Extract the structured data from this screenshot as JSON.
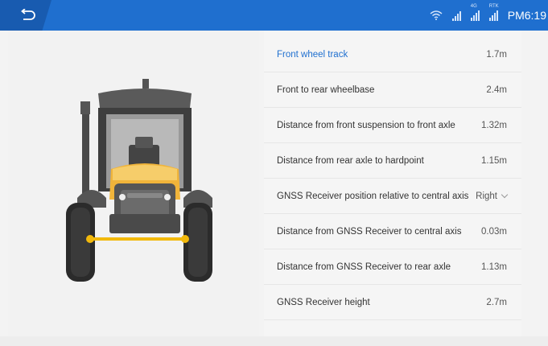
{
  "statusbar": {
    "time": "PM6:19",
    "signal_labels": [
      "4G",
      "RTK"
    ]
  },
  "settings": {
    "rows": [
      {
        "label": "Front wheel track",
        "value": "1.7m",
        "active": true
      },
      {
        "label": "Front to rear wheelbase",
        "value": "2.4m"
      },
      {
        "label": "Distance from front suspension to front axle",
        "value": "1.32m"
      },
      {
        "label": "Distance from rear axle to hardpoint",
        "value": "1.15m"
      },
      {
        "label": "GNSS Receiver position relative to central axis",
        "value": "Right",
        "dropdown": true
      },
      {
        "label": "Distance from GNSS Receiver to central axis",
        "value": "0.03m"
      },
      {
        "label": "Distance from GNSS Receiver to rear axle",
        "value": "1.13m"
      },
      {
        "label": "GNSS Receiver height",
        "value": "2.7m"
      }
    ]
  },
  "colors": {
    "topbar": "#1f6fcf",
    "accent": "#1f6fcf",
    "highlight_axle": "#f2b90c",
    "tractor_body": "#4a4a4a",
    "tractor_hood": "#f0b43a"
  },
  "icons": {
    "back": "back-arrow-icon",
    "wifi": "wifi-icon",
    "signal": "cell-signal-icon"
  }
}
